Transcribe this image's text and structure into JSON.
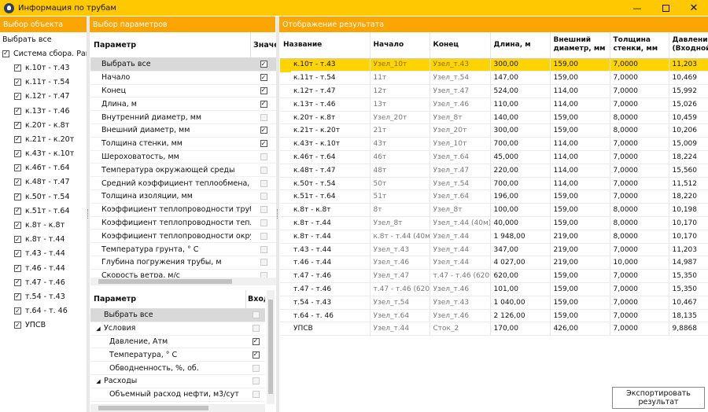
{
  "window": {
    "title": "Информация по трубам"
  },
  "panes": {
    "objects_title": "Выбор объекта",
    "params_title": "Выбор параметров",
    "results_title": "Отображение результата"
  },
  "objects": {
    "select_all": "Выбрать все",
    "root": "Система сбора. Равно",
    "items": [
      "к.10т - т.43",
      "к.11т - т.54",
      "к.12т - т.47",
      "к.13т - т.46",
      "к.20т - к.8т",
      "к.21т - к.20т",
      "к.43т - к.10т",
      "к.46т - т.64",
      "к.48т - т.47",
      "к.50т - т.54",
      "к.51т - т.64",
      "к.8т - к.8т",
      "к.8т - т.44",
      "т.43 - т.44",
      "т.46 - т.44",
      "т.47 - т.46",
      "т.54 - т.43",
      "т.64 - т. 46",
      "УПСВ"
    ]
  },
  "params_top": {
    "col_name": "Параметр",
    "col_value": "Значен",
    "rows": [
      {
        "name": "Выбрать все",
        "checked": true
      },
      {
        "name": "Начало",
        "checked": true
      },
      {
        "name": "Конец",
        "checked": true
      },
      {
        "name": "Длина, м",
        "checked": true
      },
      {
        "name": "Внутренний диаметр,  мм",
        "checked": false
      },
      {
        "name": "Внешний диаметр, мм",
        "checked": true
      },
      {
        "name": "Толщина стенки, мм",
        "checked": true
      },
      {
        "name": "Шероховатость, мм",
        "checked": false
      },
      {
        "name": "Температура окружающей среды",
        "checked": false
      },
      {
        "name": "Средний коэффициент теплообмена, Вт /...",
        "checked": false
      },
      {
        "name": "Толщина изоляции, мм",
        "checked": false
      },
      {
        "name": "Коэффициент теплопроводности трубы, В...",
        "checked": false
      },
      {
        "name": "Коэффициент теплопроводности теплово...",
        "checked": false
      },
      {
        "name": "Коэффициент теплопроводности окружа...",
        "checked": false
      },
      {
        "name": "Температура грунта,  ° С",
        "checked": false
      },
      {
        "name": "Глубина погружения трубы,  м",
        "checked": false
      },
      {
        "name": "Скорость ветра, м/с",
        "checked": false
      }
    ]
  },
  "params_bottom": {
    "col_name": "Параметр",
    "col_value": "Вход",
    "rows": [
      {
        "name": "Выбрать все",
        "level": 0,
        "tri": "",
        "checked": false,
        "sel": true
      },
      {
        "name": "Условия",
        "level": 0,
        "tri": "◢",
        "checked": false,
        "sel": false
      },
      {
        "name": "Давление, Атм",
        "level": 1,
        "tri": "",
        "checked": true,
        "sel": false
      },
      {
        "name": "Температура, ° С",
        "level": 1,
        "tri": "",
        "checked": true,
        "sel": false
      },
      {
        "name": "Обводненность, %, об.",
        "level": 1,
        "tri": "",
        "checked": false,
        "sel": false
      },
      {
        "name": "Расходы",
        "level": 0,
        "tri": "◢",
        "checked": false,
        "sel": false
      },
      {
        "name": "Объемный расход нефти, м3/сут",
        "level": 1,
        "tri": "",
        "checked": false,
        "sel": false
      }
    ]
  },
  "results": {
    "columns": [
      "Название",
      "Начало",
      "Конец",
      "Длина, м",
      "Внешний диаметр, мм",
      "Толщина стенки, мм",
      "Давление, (Входной)"
    ],
    "rows": [
      [
        "к.10т - т.43",
        "Узел_10т",
        "Узел_т.43",
        "300,00",
        "159,00",
        "7,0000",
        "11,203"
      ],
      [
        "к.11т - т.54",
        "11т",
        "Узел_т.54",
        "147,00",
        "159,00",
        "7,0000",
        "10,469"
      ],
      [
        "к.12т - т.47",
        "12т",
        "Узел_т.47",
        "524,00",
        "114,00",
        "7,0000",
        "15,992"
      ],
      [
        "к.13т - т.46",
        "13т",
        "Узел_т.46",
        "110,00",
        "114,00",
        "7,0000",
        "15,026"
      ],
      [
        "к.20т - к.8т",
        "Узел_20т",
        "Узел_8т",
        "140,00",
        "159,00",
        "8,0000",
        "10,459"
      ],
      [
        "к.21т - к.20т",
        "21т",
        "Узел_20т",
        "300,00",
        "159,00",
        "8,0000",
        "10,206"
      ],
      [
        "к.43т - к.10т",
        "43т",
        "Узел_10т",
        "700,00",
        "114,00",
        "7,0000",
        "15,009"
      ],
      [
        "к.46т - т.64",
        "46т",
        "Узел_т.64",
        "45,000",
        "114,00",
        "7,0000",
        "18,224"
      ],
      [
        "к.48т - т.47",
        "48т",
        "Узел_т.47",
        "220,00",
        "114,00",
        "7,0000",
        "15,560"
      ],
      [
        "к.50т - т.54",
        "50т",
        "Узел_т.54",
        "700,00",
        "114,00",
        "7,0000",
        "11,512"
      ],
      [
        "к.51т - т.64",
        "51т",
        "Узел_т.64",
        "196,00",
        "159,00",
        "7,0000",
        "18,220"
      ],
      [
        "к.8т - к.8т",
        "8т",
        "Узел_8т",
        "100,00",
        "159,00",
        "8,0000",
        "10,198"
      ],
      [
        "к.8т - т.44",
        "Узел_8т",
        "Узел_т.44 (40м)",
        "40,000",
        "159,00",
        "8,0000",
        "10,170"
      ],
      [
        "к.8т - т.44",
        "к.8т - т.44 (40м)",
        "Узел_т.44",
        "1 948,00",
        "219,00",
        "8,0000",
        "10,170"
      ],
      [
        "т.43 - т.44",
        "Узел_т.43",
        "Узел_т.44",
        "347,00",
        "219,00",
        "7,0000",
        "11,203"
      ],
      [
        "т.46 - т.44",
        "Узел_т.46",
        "Узел_т.44",
        "4 027,00",
        "219,00",
        "10,000",
        "14,987"
      ],
      [
        "т.47 - т.46",
        "Узел_т.47",
        "т.47 - т.46 (620м)",
        "620,00",
        "159,00",
        "7,0000",
        "15,350"
      ],
      [
        "т.47 - т.46",
        "т.47 - т.46 (620м)",
        "Узел_т.46",
        "101,00",
        "159,00",
        "7,0000",
        "15,350"
      ],
      [
        "т.54 - т.43",
        "Узел_т.54",
        "Узел_т.43",
        "1 040,00",
        "159,00",
        "7,0000",
        "10,467"
      ],
      [
        "т.64 - т. 46",
        "Узел_т.64",
        "Узел_т.46",
        "2 126,00",
        "159,00",
        "7,0000",
        "18,135"
      ],
      [
        "УПСВ",
        "Узел_т.44",
        "Сток_2",
        "170,00",
        "426,00",
        "7,0000",
        "9,8868"
      ]
    ]
  },
  "export_label": "Экспортировать результат",
  "colors": {
    "titlebar": "#ffc800",
    "header": "#fca400",
    "highlight": "#ffd400"
  }
}
